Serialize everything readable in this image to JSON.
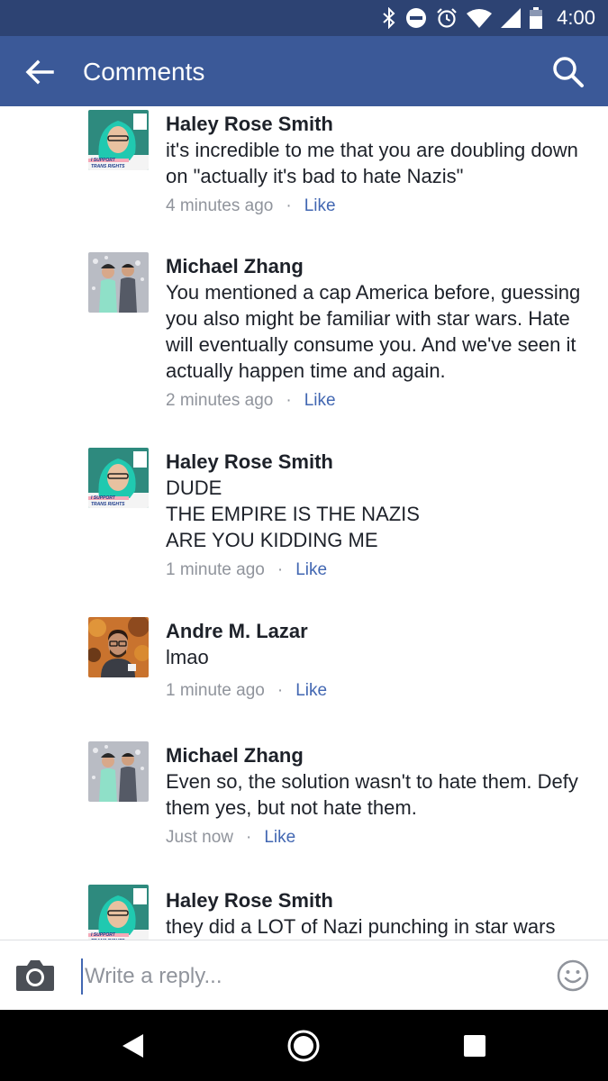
{
  "status_bar": {
    "time": "4:00",
    "icons": [
      "bluetooth-icon",
      "do-not-disturb-icon",
      "alarm-icon",
      "wifi-icon",
      "cellular-signal-icon",
      "battery-icon"
    ]
  },
  "header": {
    "title": "Comments",
    "back_icon": "back-arrow-icon",
    "search_icon": "search-icon"
  },
  "comments": [
    {
      "author": "Haley Rose Smith",
      "text": "it's incredible to me that you are doubling down on \"actually it's bad to hate Nazis\"",
      "time": "4 minutes ago",
      "like_label": "Like",
      "avatar": "haley-rose-smith-avatar"
    },
    {
      "author": "Michael Zhang",
      "text": "You mentioned a cap America before, guessing you also might be familiar with star wars. Hate will eventually consume you. And we've seen it actually happen time and again.",
      "time": "2 minutes ago",
      "like_label": "Like",
      "avatar": "michael-zhang-avatar"
    },
    {
      "author": "Haley Rose Smith",
      "text": "DUDE\nTHE EMPIRE IS THE NAZIS\nARE YOU KIDDING ME",
      "time": "1 minute ago",
      "like_label": "Like",
      "avatar": "haley-rose-smith-avatar"
    },
    {
      "author": "Andre M. Lazar",
      "text": "lmao",
      "time": "1 minute ago",
      "like_label": "Like",
      "avatar": "andre-m-lazar-avatar"
    },
    {
      "author": "Michael Zhang",
      "text": "Even so, the solution wasn't to hate them. Defy them yes, but not hate them.",
      "time": "Just now",
      "like_label": "Like",
      "avatar": "michael-zhang-avatar"
    },
    {
      "author": "Haley Rose Smith",
      "text": "they did a LOT of Nazi punching in star wars",
      "time": "",
      "like_label": "",
      "avatar": "haley-rose-smith-avatar"
    }
  ],
  "avatar_badge": {
    "line1": "I SUPPORT",
    "line2": "TRANS RIGHTS"
  },
  "reply_bar": {
    "placeholder": "Write a reply...",
    "camera_icon": "camera-icon",
    "emoji_icon": "emoji-icon"
  },
  "nav_bar": {
    "icons": [
      "nav-back-icon",
      "nav-home-icon",
      "nav-recents-icon"
    ]
  },
  "colors": {
    "status_bar": "#2d4373",
    "app_bar": "#3b5998",
    "link": "#4267b2",
    "meta_text": "#90949c",
    "body_text": "#1d2129"
  }
}
